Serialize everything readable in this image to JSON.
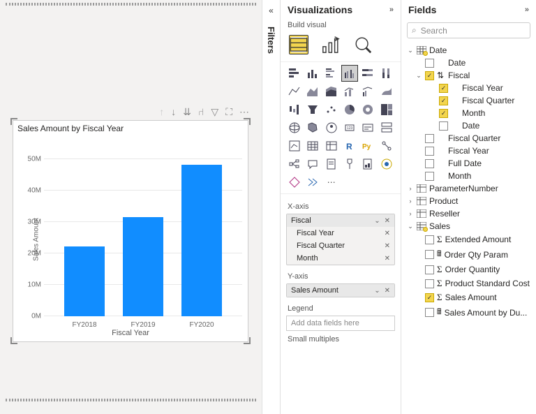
{
  "canvas": {
    "toolbar_icons": [
      "arrow-up",
      "arrow-down",
      "drill-down",
      "drill-expand",
      "filter",
      "focus",
      "more"
    ]
  },
  "chart_data": {
    "type": "bar",
    "title": "Sales Amount by Fiscal Year",
    "xlabel": "Fiscal Year",
    "ylabel": "Sales Amount",
    "categories": [
      "FY2018",
      "FY2019",
      "FY2020"
    ],
    "values": [
      24000000,
      34000000,
      52000000
    ],
    "yticks": [
      0,
      10000000,
      20000000,
      30000000,
      40000000,
      50000000
    ],
    "ytick_labels": [
      "0M",
      "10M",
      "20M",
      "30M",
      "40M",
      "50M"
    ],
    "ylim": [
      0,
      55000000
    ]
  },
  "filters_label": "Filters",
  "viz": {
    "title": "Visualizations",
    "subtitle": "Build visual",
    "wells": {
      "xaxis": {
        "label": "X-axis",
        "group": "Fiscal",
        "items": [
          "Fiscal Year",
          "Fiscal Quarter",
          "Month"
        ]
      },
      "yaxis": {
        "label": "Y-axis",
        "items": [
          "Sales Amount"
        ]
      },
      "legend": {
        "label": "Legend",
        "placeholder": "Add data fields here"
      },
      "small_multiples": {
        "label": "Small multiples"
      }
    }
  },
  "fields": {
    "title": "Fields",
    "search_placeholder": "Search",
    "tables": [
      {
        "name": "Date",
        "expanded": true,
        "children": [
          {
            "name": "Date",
            "checked": false,
            "type": "field"
          },
          {
            "name": "Fiscal",
            "checked": true,
            "type": "hierarchy",
            "expanded": true,
            "children": [
              {
                "name": "Fiscal Year",
                "checked": true
              },
              {
                "name": "Fiscal Quarter",
                "checked": true
              },
              {
                "name": "Month",
                "checked": true
              },
              {
                "name": "Date",
                "checked": false
              }
            ]
          },
          {
            "name": "Fiscal Quarter",
            "checked": false,
            "type": "field"
          },
          {
            "name": "Fiscal Year",
            "checked": false,
            "type": "field"
          },
          {
            "name": "Full Date",
            "checked": false,
            "type": "field"
          },
          {
            "name": "Month",
            "checked": false,
            "type": "field"
          }
        ]
      },
      {
        "name": "ParameterNumber",
        "expanded": false
      },
      {
        "name": "Product",
        "expanded": false
      },
      {
        "name": "Reseller",
        "expanded": false
      },
      {
        "name": "Sales",
        "expanded": true,
        "children": [
          {
            "name": "Extended Amount",
            "checked": false,
            "type": "sum"
          },
          {
            "name": "Order Qty Param",
            "checked": false,
            "type": "calc"
          },
          {
            "name": "Order Quantity",
            "checked": false,
            "type": "sum"
          },
          {
            "name": "Product Standard Cost",
            "checked": false,
            "type": "sum"
          },
          {
            "name": "Sales Amount",
            "checked": true,
            "type": "sum"
          },
          {
            "name": "Sales Amount by Du...",
            "checked": false,
            "type": "calc"
          }
        ]
      }
    ]
  }
}
